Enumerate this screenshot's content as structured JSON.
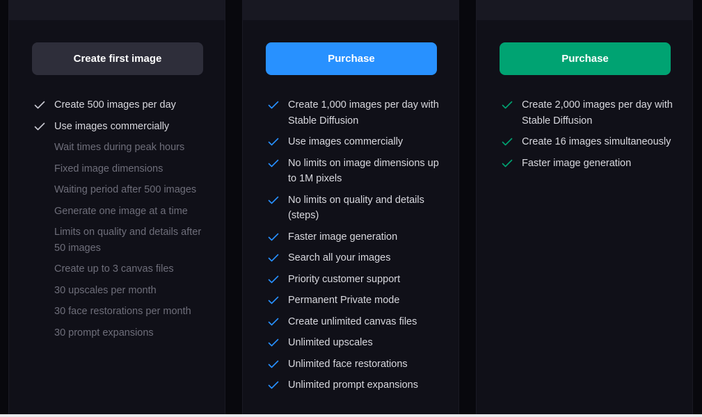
{
  "colors": {
    "page_bg": "#08080d",
    "card_bg": "#101018",
    "card_header": "#181822",
    "free_button": "#2e2e3a",
    "blue_accent": "#2891ff",
    "green_accent": "#00a372",
    "feature_text": "#d8d8de",
    "disabled_text": "#6e6e7a"
  },
  "plans": [
    {
      "button_label": "Create first image",
      "features": [
        {
          "text": "Create 500 images per day",
          "included": true
        },
        {
          "text": "Use images commercially",
          "included": true
        },
        {
          "text": "Wait times during peak hours",
          "included": false
        },
        {
          "text": "Fixed image dimensions",
          "included": false
        },
        {
          "text": "Waiting period after 500 images",
          "included": false
        },
        {
          "text": "Generate one image at a time",
          "included": false
        },
        {
          "text": "Limits on quality and details after 50 images",
          "included": false
        },
        {
          "text": "Create up to 3 canvas files",
          "included": false
        },
        {
          "text": "30 upscales per month",
          "included": false
        },
        {
          "text": "30 face restorations per month",
          "included": false
        },
        {
          "text": "30 prompt expansions",
          "included": false
        }
      ]
    },
    {
      "button_label": "Purchase",
      "features": [
        {
          "text": "Create 1,000 images per day with Stable Diffusion",
          "included": true
        },
        {
          "text": "Use images commercially",
          "included": true
        },
        {
          "text": "No limits on image dimensions up to 1M pixels",
          "included": true
        },
        {
          "text": "No limits on quality and details (steps)",
          "included": true
        },
        {
          "text": "Faster image generation",
          "included": true
        },
        {
          "text": "Search all your images",
          "included": true
        },
        {
          "text": "Priority customer support",
          "included": true
        },
        {
          "text": "Permanent Private mode",
          "included": true
        },
        {
          "text": "Create unlimited canvas files",
          "included": true
        },
        {
          "text": "Unlimited upscales",
          "included": true
        },
        {
          "text": "Unlimited face restorations",
          "included": true
        },
        {
          "text": "Unlimited prompt expansions",
          "included": true
        }
      ]
    },
    {
      "button_label": "Purchase",
      "features": [
        {
          "text": "Create 2,000 images per day with Stable Diffusion",
          "included": true
        },
        {
          "text": "Create 16 images simultaneously",
          "included": true
        },
        {
          "text": "Faster image generation",
          "included": true
        }
      ]
    }
  ]
}
